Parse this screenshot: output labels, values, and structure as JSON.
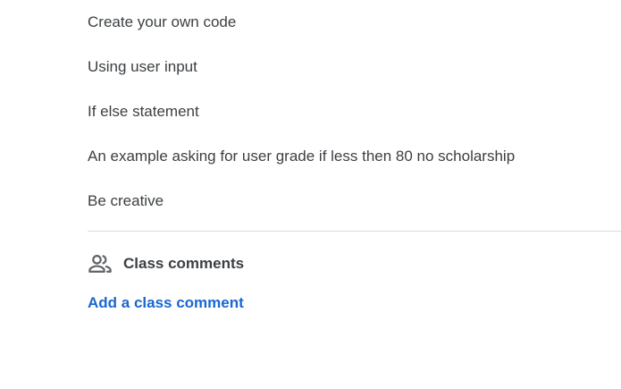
{
  "instructions": [
    "Create your own code",
    "Using user input",
    "If else statement",
    "An example asking for user grade if less then 80 no scholarship",
    "Be creative"
  ],
  "class_comments": {
    "title": "Class comments",
    "icon": "people-icon",
    "add_link": "Add a class comment"
  },
  "colors": {
    "text": "#3c4043",
    "link": "#1967d2",
    "divider": "#dadce0"
  }
}
